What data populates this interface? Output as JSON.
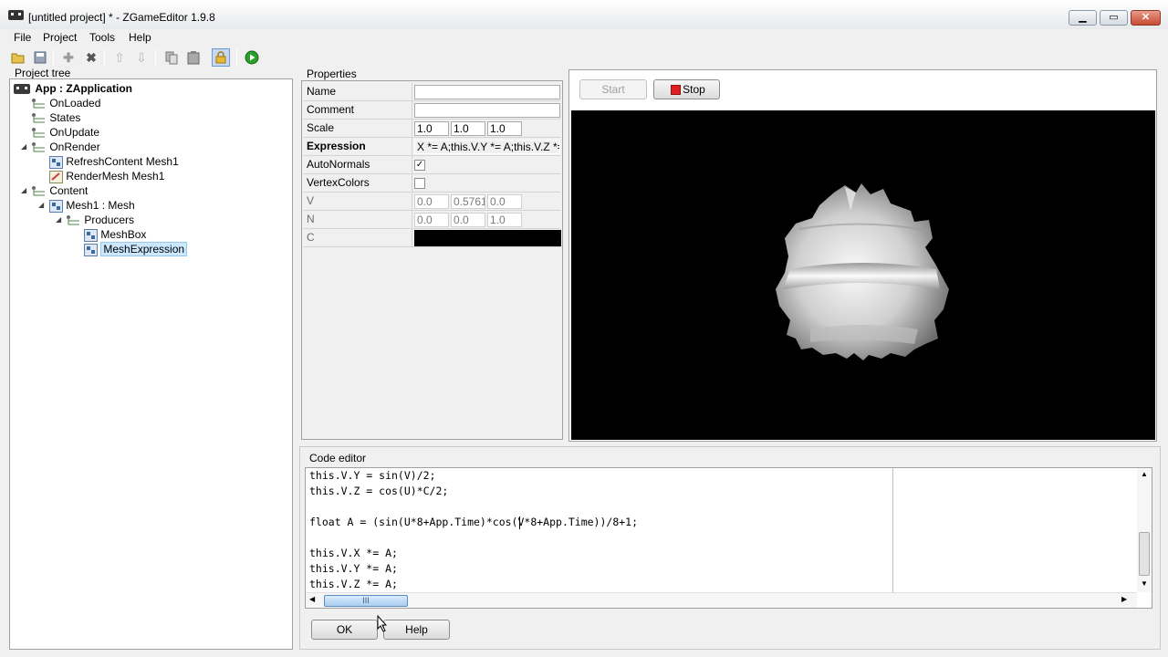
{
  "window": {
    "title": "[untitled project] * - ZGameEditor 1.9.8"
  },
  "menu": [
    "File",
    "Project",
    "Tools",
    "Help"
  ],
  "toolbar_icons": [
    "open-icon",
    "save-icon",
    "add-icon",
    "delete-icon",
    "move-up-icon",
    "move-down-icon",
    "copy-icon",
    "paste-icon",
    "lock-icon",
    "run-icon"
  ],
  "project_tree": {
    "label": "Project tree",
    "nodes": [
      {
        "label": "App : ZApplication",
        "bold": true
      },
      {
        "label": "OnLoaded"
      },
      {
        "label": "States"
      },
      {
        "label": "OnUpdate"
      },
      {
        "label": "OnRender"
      },
      {
        "label": "RefreshContent  Mesh1"
      },
      {
        "label": "RenderMesh  Mesh1"
      },
      {
        "label": "Content"
      },
      {
        "label": "Mesh1 : Mesh"
      },
      {
        "label": "Producers"
      },
      {
        "label": "MeshBox"
      },
      {
        "label": "MeshExpression"
      }
    ]
  },
  "properties": {
    "label": "Properties",
    "rows": {
      "name": {
        "label": "Name",
        "value": ""
      },
      "comment": {
        "label": "Comment",
        "value": ""
      },
      "scale": {
        "label": "Scale",
        "values": [
          "1.0",
          "1.0",
          "1.0"
        ]
      },
      "expression": {
        "label": "Expression",
        "value": "X *= A;this.V.Y *= A;this.V.Z *= A;"
      },
      "autonormals": {
        "label": "AutoNormals",
        "checked": true
      },
      "vertexcolors": {
        "label": "VertexColors",
        "checked": false
      },
      "v": {
        "label": "V",
        "values": [
          "0.0",
          "0.5761",
          "0.0"
        ]
      },
      "n": {
        "label": "N",
        "values": [
          "0.0",
          "0.0",
          "1.0"
        ]
      },
      "c": {
        "label": "C",
        "color": "#000000"
      }
    }
  },
  "preview": {
    "start_label": "Start",
    "stop_label": "Stop"
  },
  "code_editor": {
    "label": "Code editor",
    "lines": [
      "this.V.Y = sin(V)/2;",
      "this.V.Z = cos(U)*C/2;",
      "",
      "float A = (sin(U*8+App.Time)*cos(V*8+App.Time))/8+1;",
      "",
      "this.V.X *= A;",
      "this.V.Y *= A;",
      "this.V.Z *= A;"
    ],
    "hscroll_grip": "III"
  },
  "buttons": {
    "ok_label": "OK",
    "help_label": "Help"
  },
  "colors": {
    "selection": "#cce8ff",
    "stop_icon": "#e02020",
    "run_icon": "#22a022"
  }
}
